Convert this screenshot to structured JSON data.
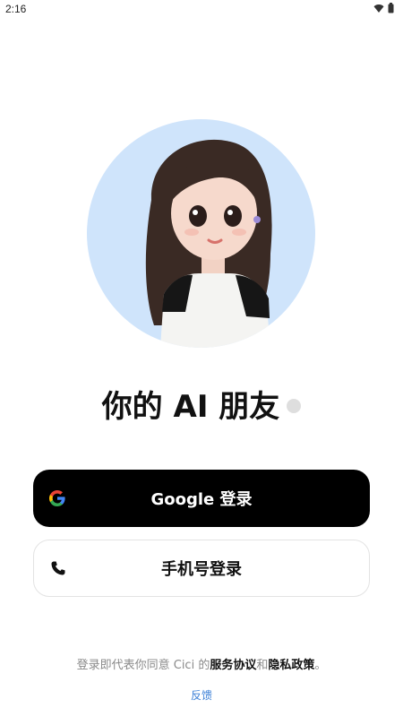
{
  "status_bar": {
    "time": "2:16",
    "icons": [
      "wifi-icon",
      "battery-icon"
    ]
  },
  "main": {
    "avatar": "ai-girl-avatar",
    "headline": "你的 AI 朋友"
  },
  "buttons": {
    "google_label": "Google 登录",
    "phone_label": "手机号登录"
  },
  "legal": {
    "prefix": "登录即代表你同意 Cici 的",
    "terms": "服务协议",
    "and": "和",
    "privacy": "隐私政策",
    "suffix": "。"
  },
  "footer": {
    "feedback": "反馈"
  },
  "colors": {
    "avatar_bg": "#cfe4fb",
    "primary_button": "#000000",
    "link_blue": "#3b7fd6"
  }
}
